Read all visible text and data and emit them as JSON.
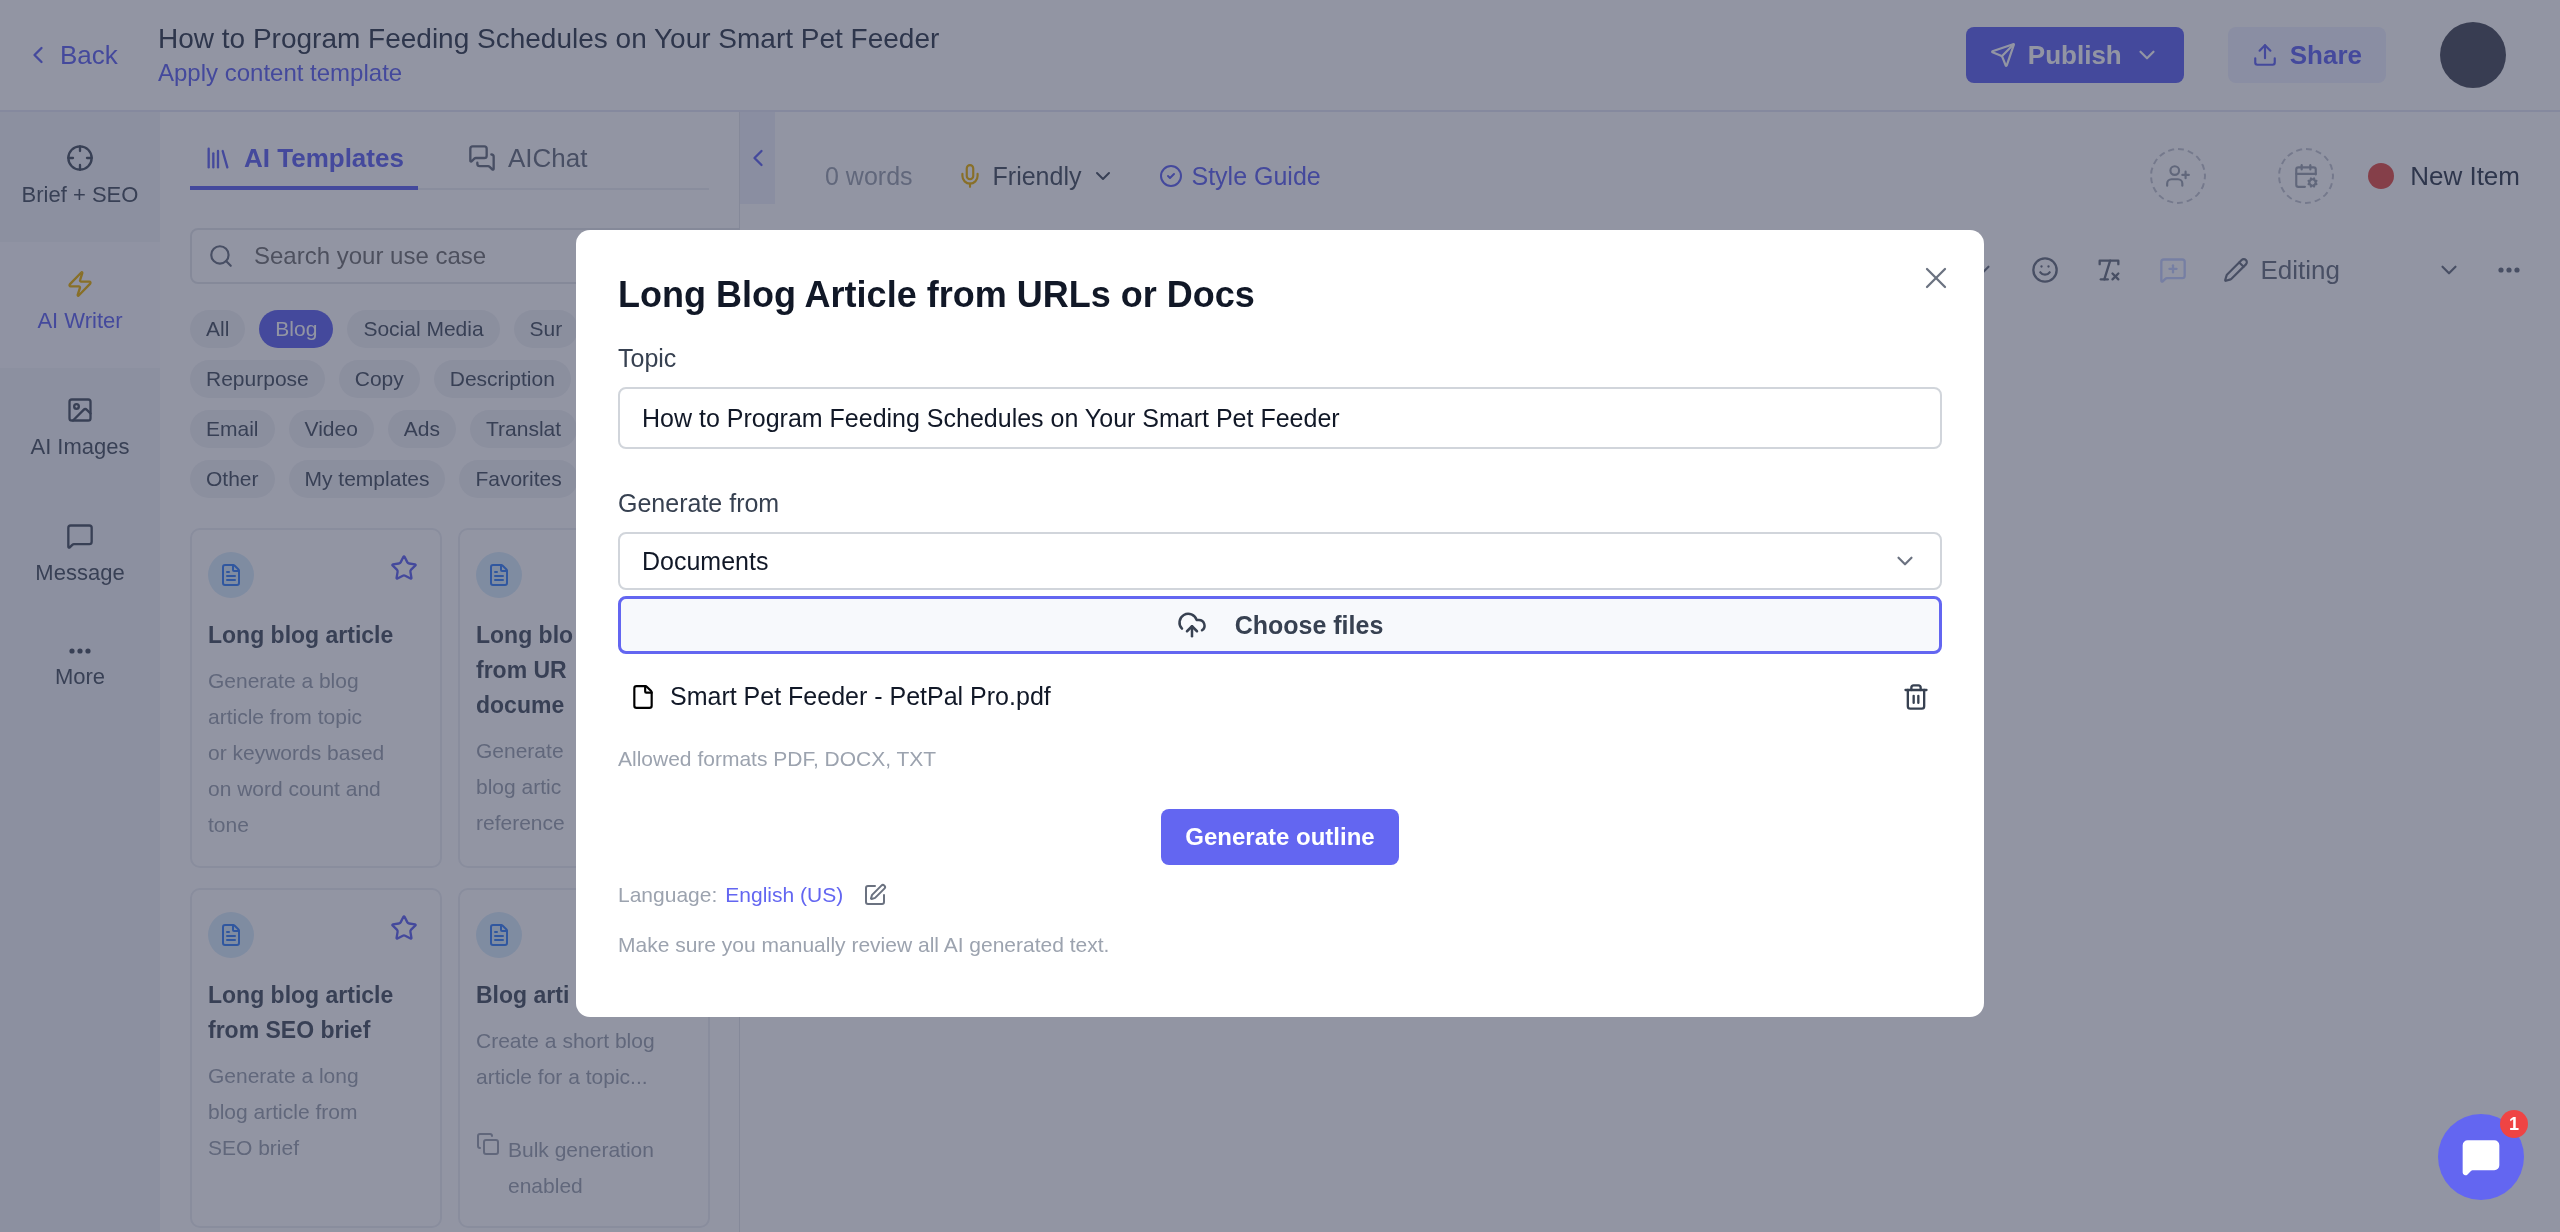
{
  "header": {
    "back": "Back",
    "title": "How to Program Feeding Schedules on Your Smart Pet Feeder",
    "subtitle": "Apply content template",
    "publish": "Publish",
    "share": "Share"
  },
  "rail": [
    {
      "label": "Brief + SEO",
      "selected": false
    },
    {
      "label": "AI Writer",
      "selected": true
    },
    {
      "label": "AI Images",
      "selected": false
    },
    {
      "label": "Message",
      "selected": false
    },
    {
      "label": "More",
      "selected": false
    }
  ],
  "panel": {
    "tabs": [
      {
        "label": "AI Templates",
        "selected": true
      },
      {
        "label": "AIChat",
        "selected": false
      }
    ],
    "search": {
      "placeholder": "Search your use case"
    },
    "chip_rows": [
      [
        {
          "label": "All",
          "selected": false
        },
        {
          "label": "Blog",
          "selected": true
        },
        {
          "label": "Social Media",
          "selected": false
        },
        {
          "label": "Sur",
          "selected": false
        }
      ],
      [
        {
          "label": "Repurpose",
          "selected": false
        },
        {
          "label": "Copy",
          "selected": false
        },
        {
          "label": "Description",
          "selected": false
        }
      ],
      [
        {
          "label": "Email",
          "selected": false
        },
        {
          "label": "Video",
          "selected": false
        },
        {
          "label": "Ads",
          "selected": false
        },
        {
          "label": "Translat",
          "selected": false
        }
      ],
      [
        {
          "label": "Other",
          "selected": false
        },
        {
          "label": "My templates",
          "selected": false
        },
        {
          "label": "Favorites",
          "selected": false
        }
      ]
    ],
    "cards": [
      {
        "title": "Long blog article",
        "description": "Generate a blog\narticle from topic\nor keywords based\non word count and\ntone",
        "show_star": true
      },
      {
        "title": "Long blo\nfrom UR\ndocume",
        "description": "Generate\nblog artic\nreference",
        "show_star": false
      },
      {
        "title": "Long blog article\nfrom SEO brief",
        "description": "Generate a long\nblog article from\nSEO brief",
        "show_star": true
      },
      {
        "title": "Blog arti",
        "description": "Create a short blog\narticle for a topic...",
        "show_star": false,
        "footer": "Bulk generation\nenabled"
      }
    ]
  },
  "editor": {
    "word_count": "0 words",
    "tone": "Friendly",
    "style_guide": "Style Guide",
    "status": "New Item",
    "mode": "Editing"
  },
  "modal": {
    "title": "Long Blog Article from URLs or Docs",
    "topic_label": "Topic",
    "topic_value": "How to Program Feeding Schedules on Your Smart Pet Feeder",
    "source_label": "Generate from",
    "source_value": "Documents",
    "upload_button": "Choose files",
    "files": [
      {
        "name": "Smart Pet Feeder - PetPal Pro.pdf"
      }
    ],
    "formats_note": "Allowed formats PDF, DOCX, TXT",
    "submit": "Generate outline",
    "language_label": "Language:",
    "language_value": "English (US)",
    "disclaimer": "Make sure you manually review all AI generated text."
  },
  "chat": {
    "badge": "1"
  }
}
